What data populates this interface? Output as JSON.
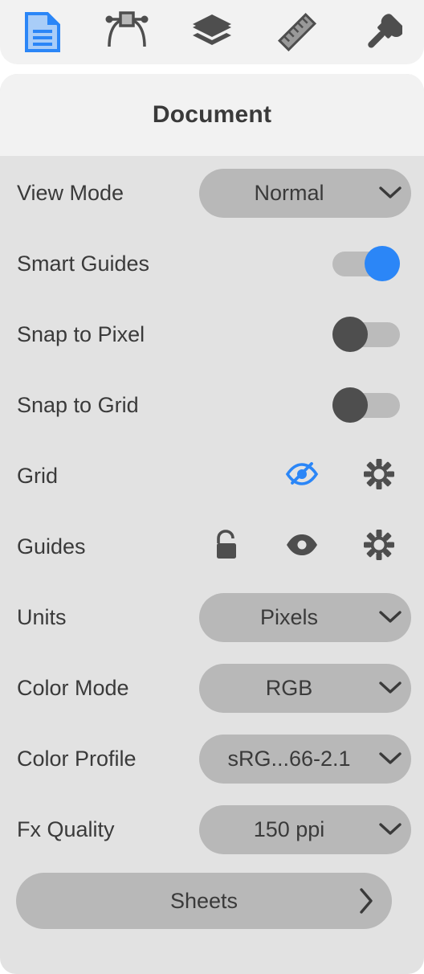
{
  "toolbar": {
    "tabs": [
      {
        "name": "document-tab",
        "icon": "document-icon",
        "active": true
      },
      {
        "name": "node-tab",
        "icon": "bezier-node-icon",
        "active": false
      },
      {
        "name": "layers-tab",
        "icon": "layers-icon",
        "active": false
      },
      {
        "name": "ruler-tab",
        "icon": "ruler-icon",
        "active": false
      },
      {
        "name": "brush-tab",
        "icon": "paintbrush-icon",
        "active": false
      }
    ]
  },
  "panel": {
    "title": "Document",
    "rows": {
      "view_mode": {
        "label": "View Mode",
        "value": "Normal"
      },
      "smart_guides": {
        "label": "Smart Guides",
        "state": "on"
      },
      "snap_to_pixel": {
        "label": "Snap to Pixel",
        "state": "off"
      },
      "snap_to_grid": {
        "label": "Snap to Grid",
        "state": "off"
      },
      "grid": {
        "label": "Grid",
        "visibility_icon": "eye-off-icon",
        "settings_icon": "gear-icon"
      },
      "guides": {
        "label": "Guides",
        "lock_icon": "unlock-icon",
        "visibility_icon": "eye-icon",
        "settings_icon": "gear-icon"
      },
      "units": {
        "label": "Units",
        "value": "Pixels"
      },
      "color_mode": {
        "label": "Color Mode",
        "value": "RGB"
      },
      "color_profile": {
        "label": "Color Profile",
        "value": "sRG...66-2.1"
      },
      "fx_quality": {
        "label": "Fx Quality",
        "value": "150 ppi"
      }
    },
    "sheets_button": {
      "label": "Sheets",
      "chevron": "chevron-right-icon"
    }
  },
  "colors": {
    "accent": "#2b86f7",
    "toolbar_bg": "#f2f2f2",
    "panel_bg": "#e2e2e2",
    "control_bg": "#b8b8b8",
    "icon_dark": "#4e4e4e",
    "text": "#3a3a3a"
  }
}
